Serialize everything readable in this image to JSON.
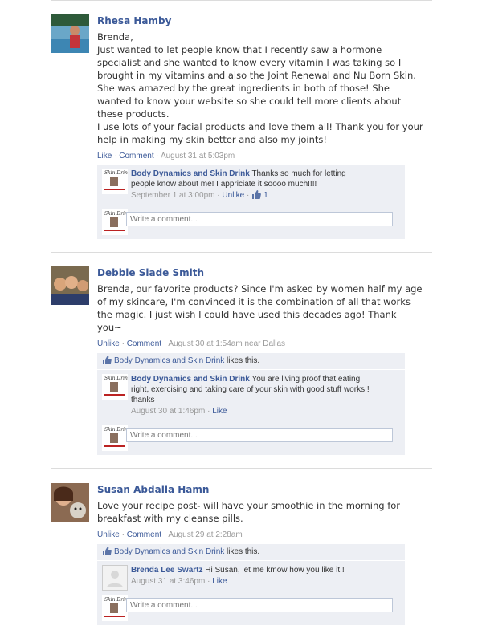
{
  "posts": [
    {
      "author": "Rhesa Hamby",
      "lines": [
        "Brenda,",
        "Just wanted to let people know that I recently saw a hormone",
        "specialist and she wanted to know every vitamin I was taking so I",
        "brought in my vitamins and also the Joint Renewal and Nu Born Skin.",
        "She was amazed by the great ingredients in both of those! She",
        "wanted to know your website so she could tell more clients about",
        "these products.",
        "I use lots of your facial products and love them all! Thank you for your",
        "help in making my skin better and also my joints!"
      ],
      "action1": "Like",
      "action2": "Comment",
      "time": "August 31 at 5:03pm",
      "replies": [
        {
          "name": "Body Dynamics and Skin Drink",
          "text_line1": "Thanks so much for letting",
          "text_line2": "people know about me! I appriciate it soooo much!!!!",
          "time": "September 1 at 3:00pm",
          "action": "Unlike",
          "like_count": "1"
        }
      ],
      "write_comment": "Write a comment..."
    },
    {
      "author": "Debbie Slade Smith",
      "lines": [
        "Brenda, our favorite products? Since I'm asked by women half my age",
        "of my skincare, I'm convinced it is the combination of all that works",
        "the magic. I just wish I could have used this decades ago! Thank",
        "you~"
      ],
      "action1": "Unlike",
      "action2": "Comment",
      "time": "August 30 at 1:54am near Dallas",
      "likes_name": "Body Dynamics and Skin Drink",
      "likes_suffix": " likes this.",
      "replies": [
        {
          "name": "Body Dynamics and Skin Drink",
          "text_line1": "You are living proof that eating",
          "text_line2": "right, exercising and taking care of your skin with good stuff works!!",
          "text_line3": "thanks",
          "time": "August 30 at 1:46pm",
          "action": "Like"
        }
      ],
      "write_comment": "Write a comment..."
    },
    {
      "author": "Susan Abdalla Hamn",
      "lines": [
        "Love your recipe post- will have your smoothie in the morning for",
        "breakfast with my cleanse pills."
      ],
      "action1": "Unlike",
      "action2": "Comment",
      "time": "August 29 at 2:28am",
      "likes_name": "Body Dynamics and Skin Drink",
      "likes_suffix": " likes this.",
      "replies": [
        {
          "name": "Brenda Lee Swartz",
          "text_line1": "Hi Susan, let me kmow how you like it!!",
          "time": "August 31 at 3:46pm",
          "action": "Like"
        }
      ],
      "write_comment": "Write a comment..."
    }
  ],
  "colors": {
    "link": "#3b5998",
    "box": "#edeff4",
    "meta": "#999999"
  }
}
